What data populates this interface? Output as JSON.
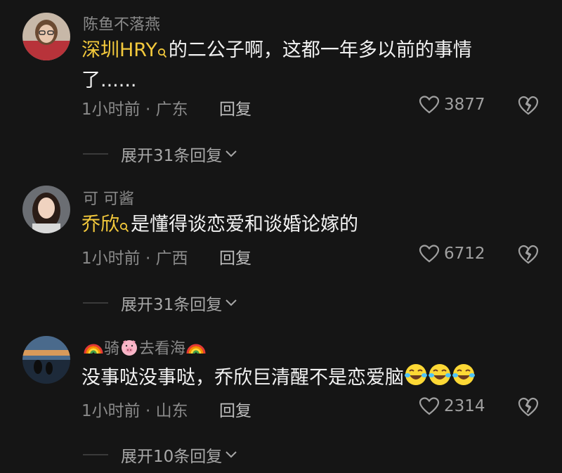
{
  "comments": [
    {
      "username": "陈鱼不落燕",
      "mention": "深圳HRY",
      "text": "的二公子啊，这都一年多以前的事情了......",
      "text_line1": "的二公子啊，这都一年多以前的事情",
      "text_line2": "了......",
      "time_location": "1小时前 · 广东",
      "reply_label": "回复",
      "likes": "3877",
      "expand_label": "展开31条回复"
    },
    {
      "username": "可 可酱",
      "mention": "乔欣",
      "text": "是懂得谈恋爱和谈婚论嫁的",
      "time_location": "1小时前 · 广西",
      "reply_label": "回复",
      "likes": "6712",
      "expand_label": "展开31条回复"
    },
    {
      "username_part1": "骑",
      "username_part2": "去看海",
      "text": "没事哒没事哒，乔欣巨清醒不是恋爱脑",
      "time_location": "1小时前 · 山东",
      "reply_label": "回复",
      "likes": "2314",
      "expand_label": "展开10条回复"
    }
  ],
  "colors": {
    "background": "#151515",
    "mention": "#f3c93c",
    "secondary_text": "#8a8a8a"
  }
}
